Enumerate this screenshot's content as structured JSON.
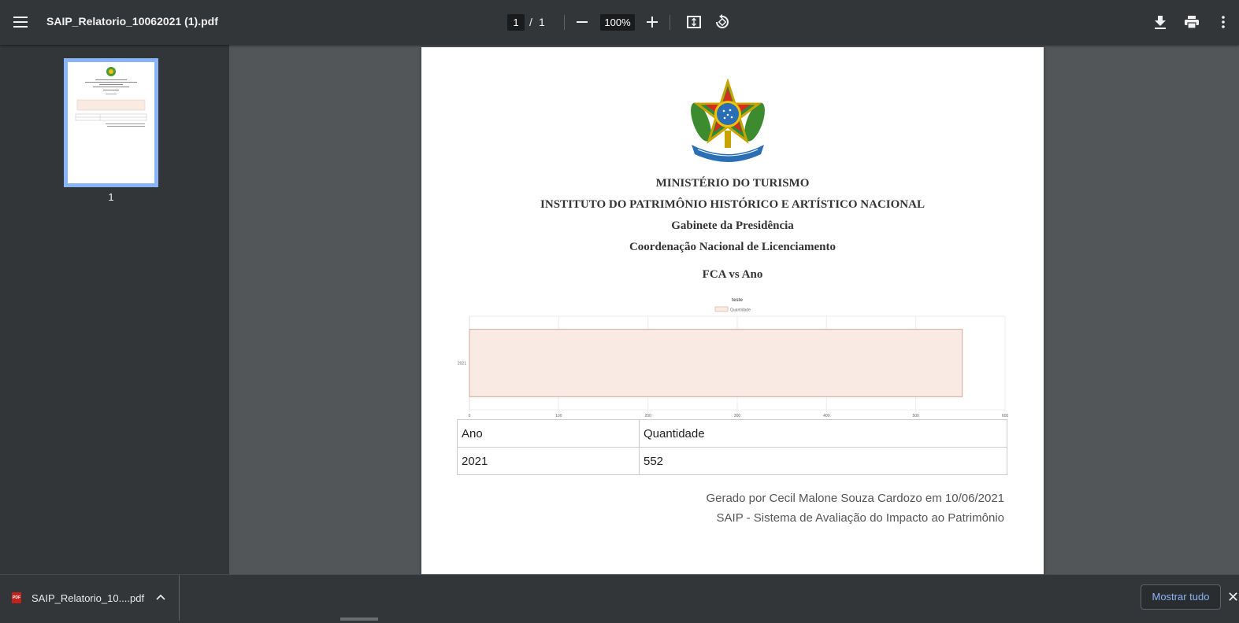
{
  "toolbar": {
    "filename": "SAIP_Relatorio_10062021 (1).pdf",
    "current_page": "1",
    "page_separator": "/",
    "total_pages": "1",
    "zoom": "100%",
    "icons": [
      "menu-icon",
      "zoom-out-icon",
      "zoom-in-icon",
      "fit-page-icon",
      "rotate-icon",
      "download-icon",
      "print-icon",
      "more-options-icon"
    ]
  },
  "sidebar": {
    "thumbnail_label": "1"
  },
  "document": {
    "line1": "MINISTÉRIO DO TURISMO",
    "line2": "INSTITUTO DO PATRIMÔNIO HISTÓRICO E ARTÍSTICO NACIONAL",
    "line3": "Gabinete da Presidência",
    "line4": "Coordenação Nacional de Licenciamento",
    "report_title": "FCA vs Ano",
    "table": {
      "headers": [
        "Ano",
        "Quantidade"
      ],
      "rows": [
        [
          "2021",
          "552"
        ]
      ]
    },
    "footer_line1": "Gerado por Cecil Malone Souza Cardozo em 10/06/2021",
    "footer_line2": "SAIP - Sistema de Avaliação do Impacto ao Patrimônio"
  },
  "chart_data": {
    "type": "bar",
    "orientation": "horizontal",
    "title": "teste",
    "categories": [
      "2021"
    ],
    "series": [
      {
        "name": "Quantidade",
        "values": [
          552
        ]
      }
    ],
    "xlim": [
      0,
      600
    ],
    "xticks": [
      "0",
      "100",
      "200",
      "300",
      "400",
      "500",
      "600"
    ],
    "grid": true,
    "legend_position": "top",
    "colors": {
      "fill": "#f9ebe3",
      "stroke": "#d4a99a"
    }
  },
  "downloads": {
    "item_name": "SAIP_Relatorio_10....pdf",
    "pdf_badge": "PDF",
    "show_all_label": "Mostrar tudo",
    "close_glyph": "✕"
  }
}
